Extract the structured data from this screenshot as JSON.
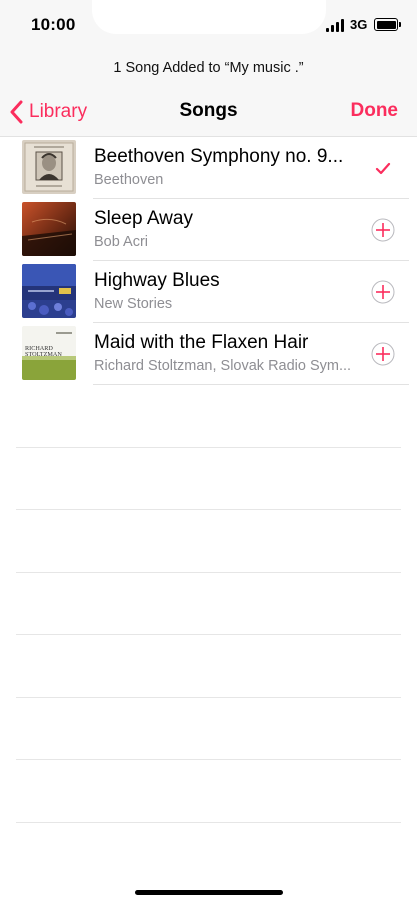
{
  "status_bar": {
    "time": "10:00",
    "network": "3G",
    "icons": [
      "signal-bars-icon",
      "battery-icon"
    ]
  },
  "header": {
    "prompt": "1 Song Added to “My music .”",
    "back_label": "Library",
    "title": "Songs",
    "done_label": "Done"
  },
  "colors": {
    "accent": "#fb2d5d",
    "subtitle_gray": "#8e8e93",
    "separator": "#e2e2e2",
    "header_bg": "#f7f7f7"
  },
  "songs": [
    {
      "title": "Beethoven Symphony no. 9...",
      "artist": "Beethoven",
      "state": "added",
      "action_icon": "checkmark-icon"
    },
    {
      "title": "Sleep Away",
      "artist": "Bob Acri",
      "state": "not-added",
      "action_icon": "add-circle-icon"
    },
    {
      "title": "Highway Blues",
      "artist": "New Stories",
      "state": "not-added",
      "action_icon": "add-circle-icon"
    },
    {
      "title": "Maid with the Flaxen Hair",
      "artist": "Richard Stoltzman, Slovak Radio Sym...",
      "state": "not-added",
      "action_icon": "add-circle-icon"
    }
  ],
  "album_art": [
    {
      "icon": "beethoven-portrait-art"
    },
    {
      "icon": "piano-dark-art"
    },
    {
      "icon": "blue-flowers-art"
    },
    {
      "icon": "richard-stoltzman-cover-art",
      "cover_text": [
        "RICHARD",
        "STOLTZMAN"
      ]
    }
  ]
}
